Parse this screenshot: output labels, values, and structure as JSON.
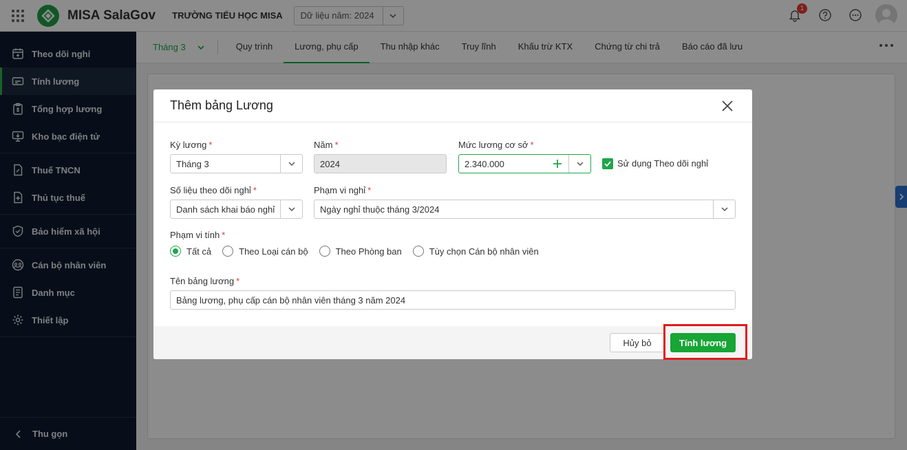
{
  "header": {
    "app_name": "MISA SalaGov",
    "org_name": "TRƯỜNG TIỂU HỌC MISA",
    "year_select": "Dữ liệu năm: 2024",
    "notification_count": "1"
  },
  "sidebar": {
    "items": [
      {
        "label": "Theo dõi nghỉ",
        "icon": "calendar-icon"
      },
      {
        "label": "Tính lương",
        "icon": "payroll-icon"
      },
      {
        "label": "Tổng hợp lương",
        "icon": "clipboard-icon"
      },
      {
        "label": "Kho bạc điện tử",
        "icon": "monitor-icon"
      },
      {
        "label": "Thuế TNCN",
        "icon": "tax-doc-icon"
      },
      {
        "label": "Thủ tục thuế",
        "icon": "doc-plus-icon"
      },
      {
        "label": "Bảo hiểm xã hội",
        "icon": "shield-icon"
      },
      {
        "label": "Cán bộ nhân viên",
        "icon": "users-icon"
      },
      {
        "label": "Danh mục",
        "icon": "list-icon"
      },
      {
        "label": "Thiết lập",
        "icon": "gear-icon"
      }
    ],
    "collapse_label": "Thu gọn"
  },
  "tabs": {
    "month": "Tháng 3",
    "items": [
      "Quy trình",
      "Lương, phụ cấp",
      "Thu nhập khác",
      "Truy lĩnh",
      "Khấu trừ KTX",
      "Chứng từ chi trả",
      "Báo cáo đã lưu"
    ],
    "active": "Lương, phụ cấp"
  },
  "modal": {
    "title": "Thêm bảng Lương",
    "ky_luong_label": "Kỳ lương",
    "ky_luong_value": "Tháng 3",
    "nam_label": "Năm",
    "nam_value": "2024",
    "muc_luong_label": "Mức lương cơ sở",
    "muc_luong_value": "2.340.000",
    "use_theo_doi_label": "Sử dụng Theo dõi nghỉ",
    "use_theo_doi_checked": true,
    "so_lieu_label": "Số liệu theo dõi nghỉ",
    "so_lieu_value": "Danh sách khai báo nghỉ",
    "pham_vi_nghi_label": "Phạm vi nghỉ",
    "pham_vi_nghi_value": "Ngày nghỉ thuộc tháng 3/2024",
    "pham_vi_tinh_label": "Phạm vi tính",
    "pham_vi_tinh_options": [
      "Tất cả",
      "Theo Loại cán bộ",
      "Theo Phòng ban",
      "Tùy chọn Cán bộ nhân viên"
    ],
    "pham_vi_tinh_selected": "Tất cả",
    "ten_bang_label": "Tên bảng lương",
    "ten_bang_value": "Bảng lương, phụ cấp cán bộ nhân viên tháng 3 năm 2024",
    "required_mark": "*",
    "cancel_label": "Hủy bỏ",
    "submit_label": "Tính lương"
  },
  "colors": {
    "accent": "#1ea649",
    "sidebar_bg": "#0d1b2e",
    "highlight": "#e01b1b"
  }
}
